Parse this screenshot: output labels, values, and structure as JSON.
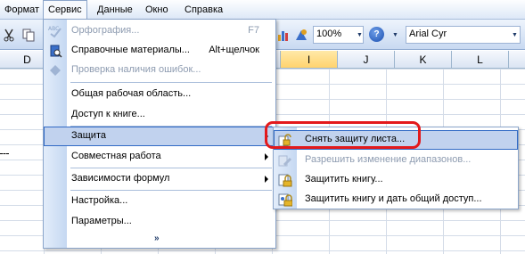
{
  "menubar": {
    "items": [
      {
        "label": "Формат"
      },
      {
        "label": "Сервис"
      },
      {
        "label": "Данные"
      },
      {
        "label": "Окно"
      },
      {
        "label": "Справка"
      }
    ]
  },
  "toolbar": {
    "zoom_value": "100%",
    "font_name": "Arial Cyr",
    "help_glyph": "?"
  },
  "grid": {
    "columns": [
      "D",
      "I",
      "J",
      "K",
      "L"
    ]
  },
  "service_menu": {
    "items": [
      {
        "label": "Орфография...",
        "shortcut": "F7",
        "icon": "spellcheck-icon",
        "disabled": true
      },
      {
        "label": "Справочные материалы...",
        "shortcut": "Alt+щелчок",
        "icon": "research-book-icon",
        "disabled": false
      },
      {
        "label": "Проверка наличия ошибок...",
        "icon": "error-check-icon",
        "disabled": true
      },
      {
        "label": "Общая рабочая область...",
        "disabled": false
      },
      {
        "label": "Доступ к книге...",
        "disabled": false
      },
      {
        "label": "Защита",
        "submenu": true,
        "highlighted": true
      },
      {
        "label": "Совместная работа",
        "submenu": true
      },
      {
        "label": "Зависимости формул",
        "submenu": true
      },
      {
        "label": "Настройка...",
        "disabled": false
      },
      {
        "label": "Параметры...",
        "disabled": false
      }
    ],
    "expand_glyph": "»"
  },
  "protection_submenu": {
    "items": [
      {
        "label": "Снять защиту листа...",
        "icon": "unlock-sheet-icon",
        "highlighted": true
      },
      {
        "label": "Разрешить изменение диапазонов...",
        "icon": "allow-ranges-icon",
        "disabled": true
      },
      {
        "label": "Защитить книгу...",
        "icon": "protect-workbook-icon"
      },
      {
        "label": "Защитить книгу и дать общий доступ...",
        "icon": "protect-share-icon"
      }
    ]
  },
  "colors": {
    "highlight": "#c1d2ee",
    "annotation_ring": "#e3191b",
    "disabled_text": "#8d9bb0"
  }
}
